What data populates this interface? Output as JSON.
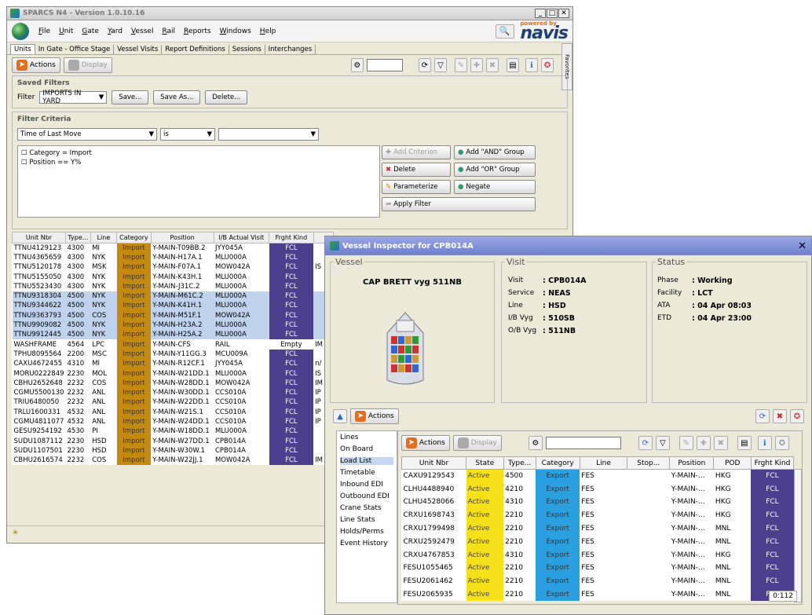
{
  "main": {
    "title": "SPARCS N4 - Version 1.0.10.16",
    "menu": [
      "File",
      "Unit",
      "Gate",
      "Yard",
      "Vessel",
      "Rail",
      "Reports",
      "Windows",
      "Help"
    ],
    "powered": "powered by",
    "logo": "navis",
    "tabs": [
      "Units",
      "In Gate - Office Stage",
      "Vessel Visits",
      "Report Definitions",
      "Sessions",
      "Interchanges"
    ],
    "favorites": "Favorites",
    "actions": "Actions",
    "display": "Display",
    "saved_filters": "Saved Filters",
    "filter_label": "Filter",
    "filter_value": "IMPORTS IN YARD",
    "save": "Save...",
    "save_as": "Save As...",
    "delete_btn": "Delete...",
    "criteria": "Filter Criteria",
    "crit_field": "Time of Last Move",
    "crit_op": "is",
    "crit_val": "",
    "tree": [
      "Category = Import",
      "Position == Y%"
    ],
    "add_criterion": "Add Criterion",
    "add_and": "Add \"AND\" Group",
    "delete": "Delete",
    "add_or": "Add \"OR\" Group",
    "parameterize": "Parameterize",
    "negate": "Negate",
    "apply": "Apply Filter",
    "columns": [
      "Unit Nbr",
      "Type...",
      "Line",
      "Category",
      "Position",
      "I/B Actual Visit",
      "Frght Kind"
    ],
    "rows": [
      [
        "TTNU4129123",
        "4300",
        "MI",
        "Import",
        "Y-MAIN-T09BB.2",
        "JYY045A",
        "FCL",
        ""
      ],
      [
        "TTNU4365659",
        "4300",
        "NYK",
        "Import",
        "Y-MAIN-H17A.1",
        "MLU000A",
        "FCL",
        ""
      ],
      [
        "TTNU5120178",
        "4300",
        "MSK",
        "Import",
        "Y-MAIN-F07A.1",
        "MOW042A",
        "FCL",
        "IS"
      ],
      [
        "TTNU5155050",
        "4300",
        "NYK",
        "Import",
        "Y-MAIN-K43H.1",
        "MLU000A",
        "FCL",
        ""
      ],
      [
        "TTNU5523430",
        "4300",
        "NYK",
        "Import",
        "Y-MAIN-J31C.2",
        "MLU000A",
        "FCL",
        ""
      ],
      [
        "TTNU9318304",
        "4500",
        "NYK",
        "Import",
        "Y-MAIN-M61C.2",
        "MLU000A",
        "FCL",
        ""
      ],
      [
        "TTNU9344622",
        "4500",
        "NYK",
        "Import",
        "Y-MAIN-K41H.1",
        "MLU000A",
        "FCL",
        ""
      ],
      [
        "TTNU9363793",
        "4500",
        "COS",
        "Import",
        "Y-MAIN-M51F.1",
        "MOW042A",
        "FCL",
        ""
      ],
      [
        "TTNU9909082",
        "4500",
        "NYK",
        "Import",
        "Y-MAIN-H23A.2",
        "MLU000A",
        "FCL",
        ""
      ],
      [
        "TTNU9912445",
        "4500",
        "NYK",
        "Import",
        "Y-MAIN-H25A.2",
        "MLU000A",
        "FCL",
        ""
      ],
      [
        "WASHFRAME",
        "4564",
        "LPC",
        "Import",
        "Y-MAIN-CFS",
        "RAIL",
        "Empty",
        "IM"
      ],
      [
        "TPHU8095564",
        "2200",
        "MSC",
        "Import",
        "Y-MAIN-Y11GG.3",
        "MCU009A",
        "FCL",
        ""
      ],
      [
        "CAXU4672455",
        "4310",
        "MI",
        "Import",
        "Y-MAIN-R12CF.1",
        "JYY045A",
        "FCL",
        "n/"
      ],
      [
        "MORU0222849",
        "2230",
        "MOL",
        "Import",
        "Y-MAIN-W21DD.1",
        "MLU000A",
        "FCL",
        "IS"
      ],
      [
        "CBHU2652648",
        "2232",
        "COS",
        "Import",
        "Y-MAIN-W28DD.1",
        "MOW042A",
        "FCL",
        "IM"
      ],
      [
        "CGMU5500130",
        "2232",
        "ANL",
        "Import",
        "Y-MAIN-W30DD.1",
        "CCS010A",
        "FCL",
        "IP"
      ],
      [
        "TRIU6480050",
        "2232",
        "ANL",
        "Import",
        "Y-MAIN-W22DD.1",
        "CCS010A",
        "FCL",
        "IP"
      ],
      [
        "TRLU1600331",
        "4532",
        "ANL",
        "Import",
        "Y-MAIN-W21S.1",
        "CCS010A",
        "FCL",
        "IP"
      ],
      [
        "CGMU4811077",
        "4532",
        "ANL",
        "Import",
        "Y-MAIN-W24DD.1",
        "CCS010A",
        "FCL",
        "IP"
      ],
      [
        "GESU9254192",
        "4530",
        "PI",
        "Import",
        "Y-MAIN-W18DD.1",
        "MLU000A",
        "FCL",
        ""
      ],
      [
        "SUDU1087112",
        "2230",
        "HSD",
        "Import",
        "Y-MAIN-W27DD.1",
        "CPB014A",
        "FCL",
        ""
      ],
      [
        "SUDU1107501",
        "2230",
        "HSD",
        "Import",
        "Y-MAIN-W30W.1",
        "CPB014A",
        "FCL",
        ""
      ],
      [
        "CBHU2616574",
        "2232",
        "COS",
        "Import",
        "Y-MAIN-W22JJ.1",
        "MOW042A",
        "FCL",
        "IM"
      ]
    ]
  },
  "inspector": {
    "title": "Vessel Inspector for CPB014A",
    "vessel_legend": "Vessel",
    "vessel_name": "CAP BRETT vyg 511NB",
    "visit_legend": "Visit",
    "visit": [
      [
        "Visit",
        ": CPB014A"
      ],
      [
        "Service",
        ": NEAS"
      ],
      [
        "Line",
        ": HSD"
      ],
      [
        "I/B Vyg",
        ": 510SB"
      ],
      [
        "O/B Vyg",
        ": 511NB"
      ]
    ],
    "status_legend": "Status",
    "status": [
      [
        "Phase",
        ": Working"
      ],
      [
        "Facility",
        ": LCT"
      ],
      [
        "ATA",
        ": 04 Apr 08:03"
      ],
      [
        "ETD",
        ": 04 Apr 23:00"
      ]
    ],
    "actions": "Actions",
    "sidebar": [
      "Lines",
      "On Board",
      "Load List",
      "Timetable",
      "Inbound EDI",
      "Outbound EDI",
      "Crane Stats",
      "Line Stats",
      "Holds/Perms",
      "Event History"
    ],
    "ll_actions": "Actions",
    "ll_display": "Display",
    "columns": [
      "Unit Nbr",
      "State",
      "Type...",
      "Category",
      "Line",
      "Stop...",
      "Position",
      "POD",
      "Frght Kind"
    ],
    "rows": [
      [
        "CAXU9129543",
        "Active",
        "4500",
        "Export",
        "FES",
        "",
        "Y-MAIN-...",
        "HKG",
        "FCL"
      ],
      [
        "CLHU4488940",
        "Active",
        "4210",
        "Export",
        "FES",
        "",
        "Y-MAIN-...",
        "HKG",
        "FCL"
      ],
      [
        "CLHU4528066",
        "Active",
        "4310",
        "Export",
        "FES",
        "",
        "Y-MAIN-...",
        "HKG",
        "FCL"
      ],
      [
        "CRXU1698743",
        "Active",
        "2210",
        "Export",
        "FES",
        "",
        "Y-MAIN-...",
        "HKG",
        "FCL"
      ],
      [
        "CRXU1799498",
        "Active",
        "2210",
        "Export",
        "FES",
        "",
        "Y-MAIN-...",
        "MNL",
        "FCL"
      ],
      [
        "CRXU2592479",
        "Active",
        "2210",
        "Export",
        "FES",
        "",
        "Y-MAIN-...",
        "MNL",
        "FCL"
      ],
      [
        "CRXU4767853",
        "Active",
        "4310",
        "Export",
        "FES",
        "",
        "Y-MAIN-...",
        "HKG",
        "FCL"
      ],
      [
        "FESU1055465",
        "Active",
        "2210",
        "Export",
        "FES",
        "",
        "Y-MAIN-...",
        "MNL",
        "FCL"
      ],
      [
        "FESU2061462",
        "Active",
        "2210",
        "Export",
        "FES",
        "",
        "Y-MAIN-...",
        "MNL",
        "FCL"
      ],
      [
        "FESU2065935",
        "Active",
        "2210",
        "Export",
        "FES",
        "",
        "Y-MAIN-...",
        "MNL",
        "FCL"
      ]
    ],
    "count": "0:112"
  }
}
